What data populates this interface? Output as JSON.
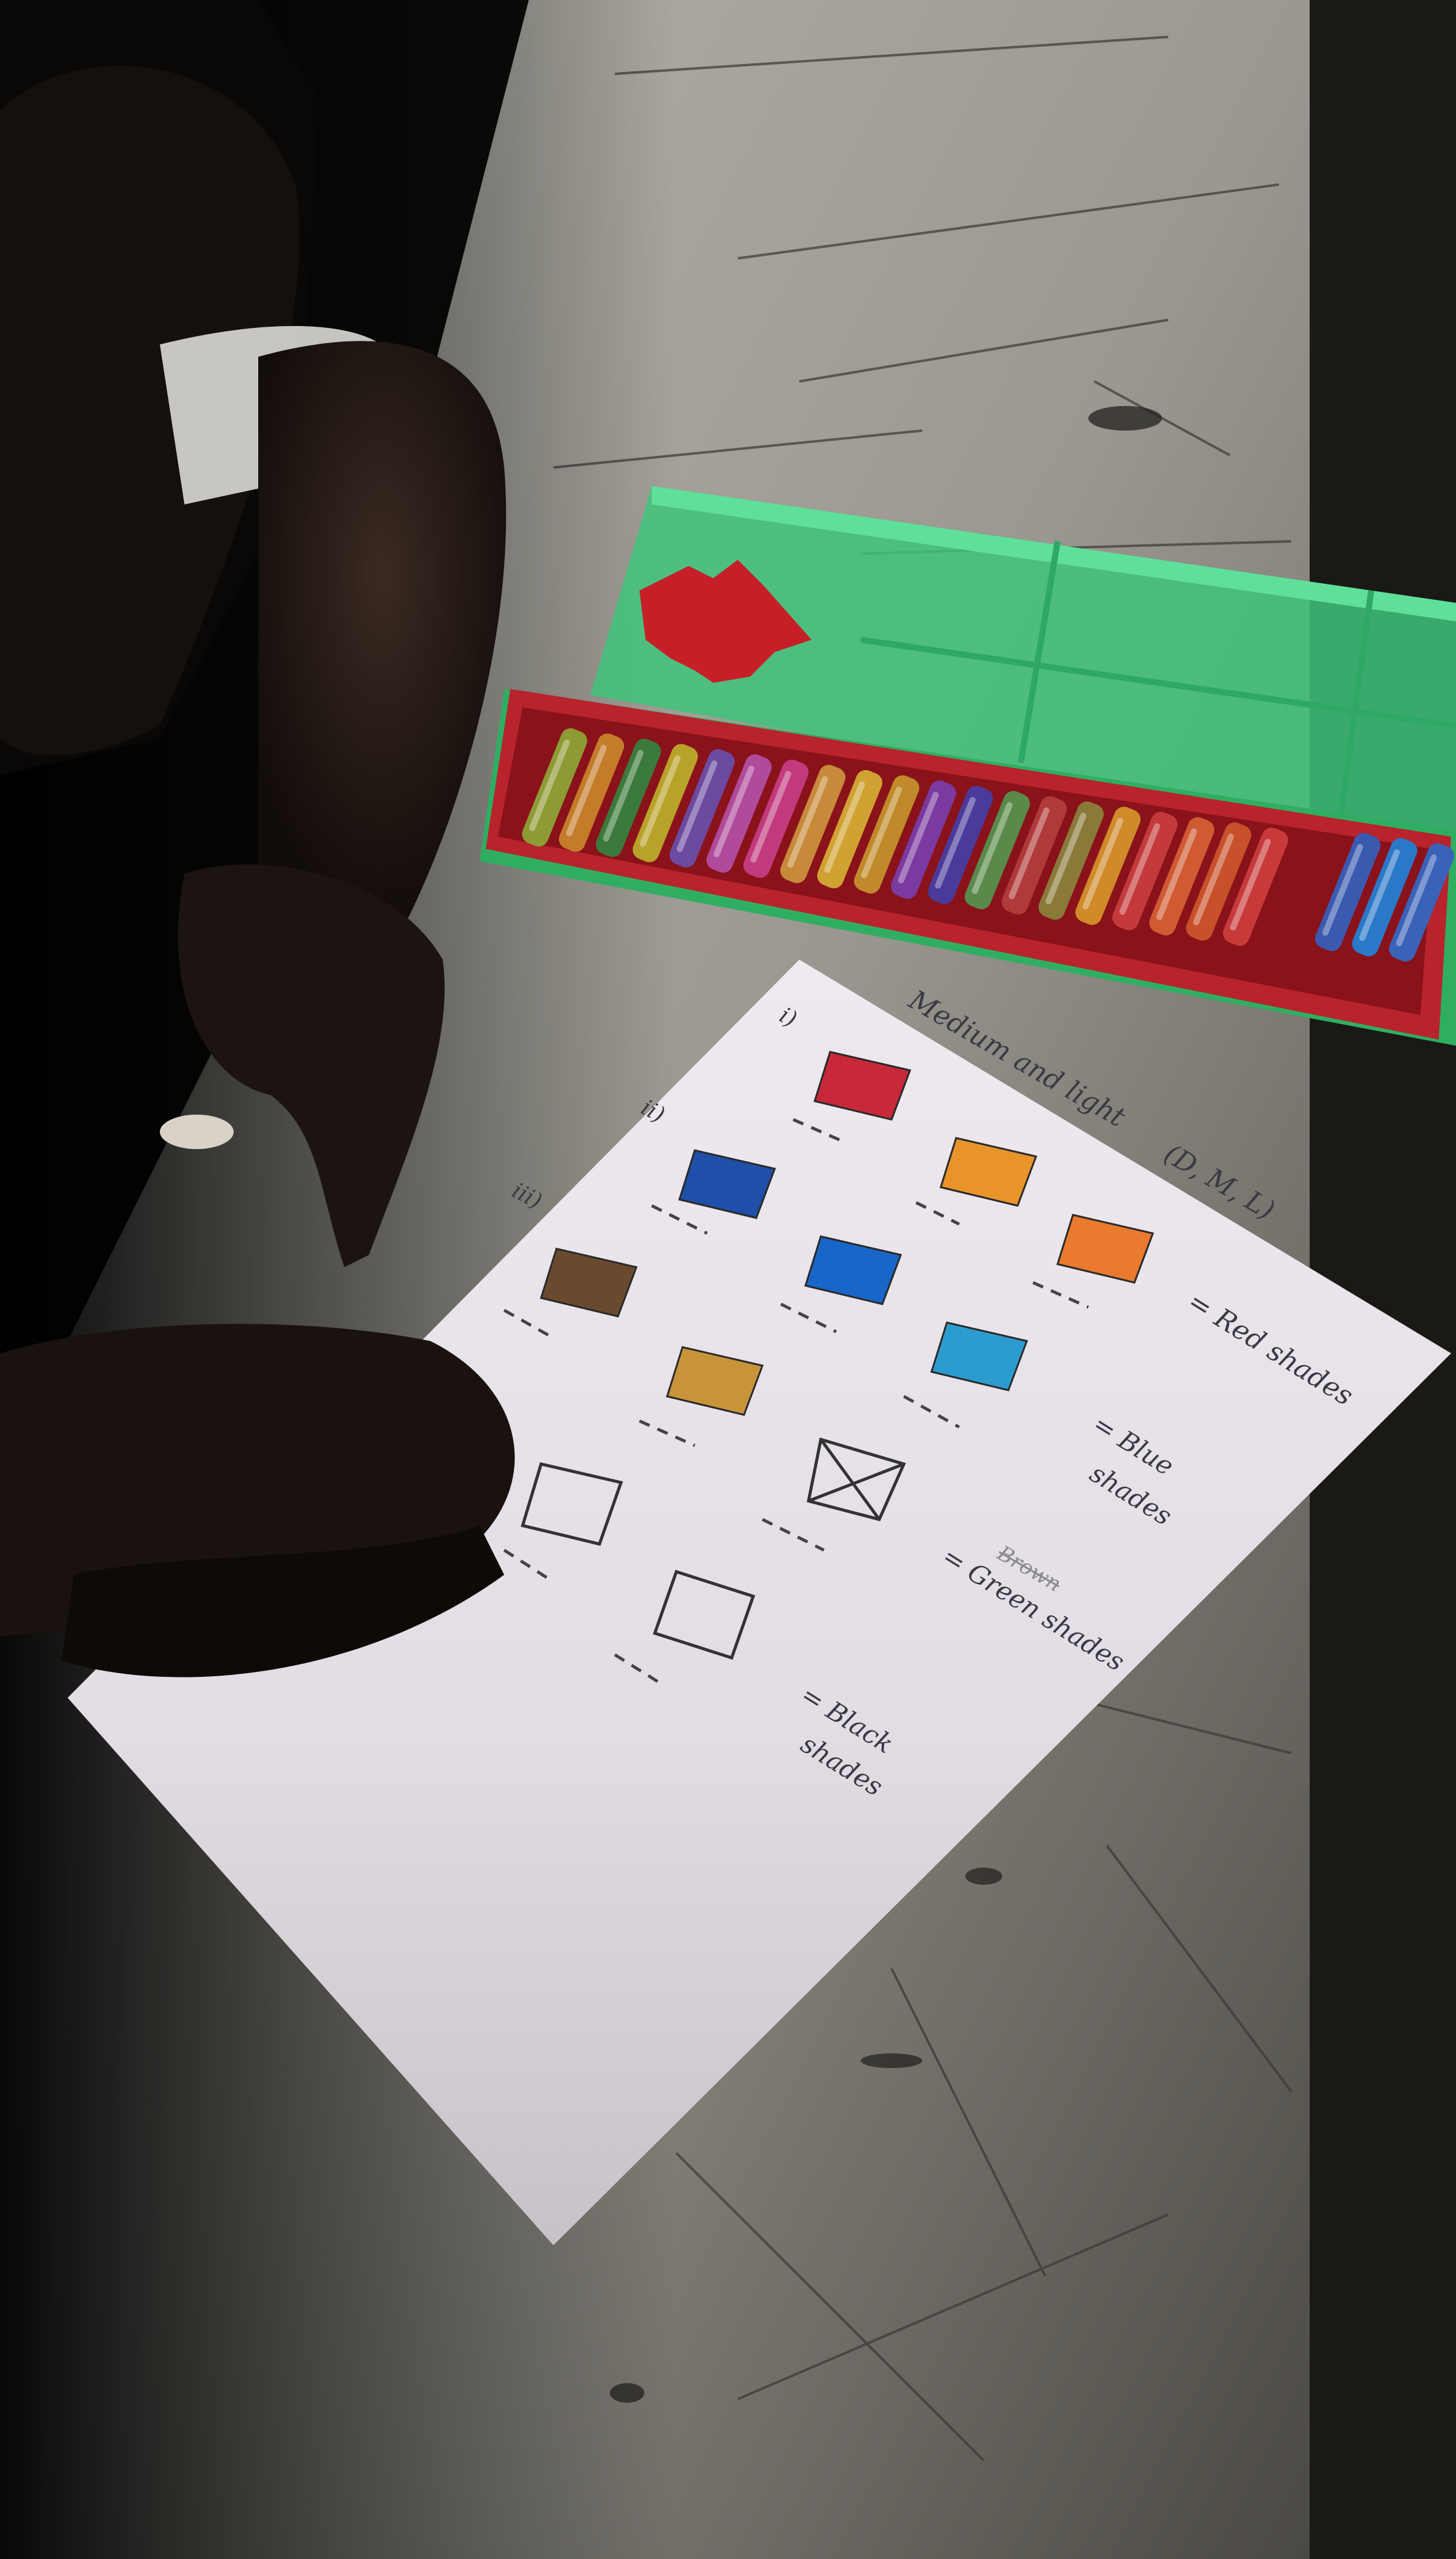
{
  "worksheet": {
    "heading_text": "Medium and light",
    "heading_code": "(D, M, L)",
    "row_numerals": [
      "i)",
      "ii)",
      "iii)"
    ],
    "labels": {
      "red": "= Red shades",
      "blue_line1": "= Blue",
      "blue_line2": "shades",
      "strike": "Brown",
      "green": "= Green shades",
      "black_line1": "= Black",
      "black_line2": "shades"
    }
  },
  "swatch_colors": {
    "red": "#c8283a",
    "orange1": "#e9932b",
    "orange2": "#e97a2e",
    "blue_dark": "#1f4fa8",
    "blue_mid": "#1766c8",
    "blue_light": "#2c9ccf",
    "brown": "#6a4a2e",
    "ochre": "#c8943a"
  },
  "crayon_colors": [
    "#8e9a34",
    "#c47c2a",
    "#3b7a3a",
    "#b9a22a",
    "#6b4aa0",
    "#b04a9a",
    "#c23a7e",
    "#c88a3a",
    "#d0a232",
    "#c08a2a",
    "#7a3aa0",
    "#4a3a9a",
    "#5a8a4a",
    "#b03a3a",
    "#8a7a3a",
    "#d08a2a",
    "#c43a3a",
    "#d05a32",
    "#c8502a",
    "#c83a3a",
    "#3a5ab0",
    "#2a78c8",
    "#3a62b8"
  ]
}
